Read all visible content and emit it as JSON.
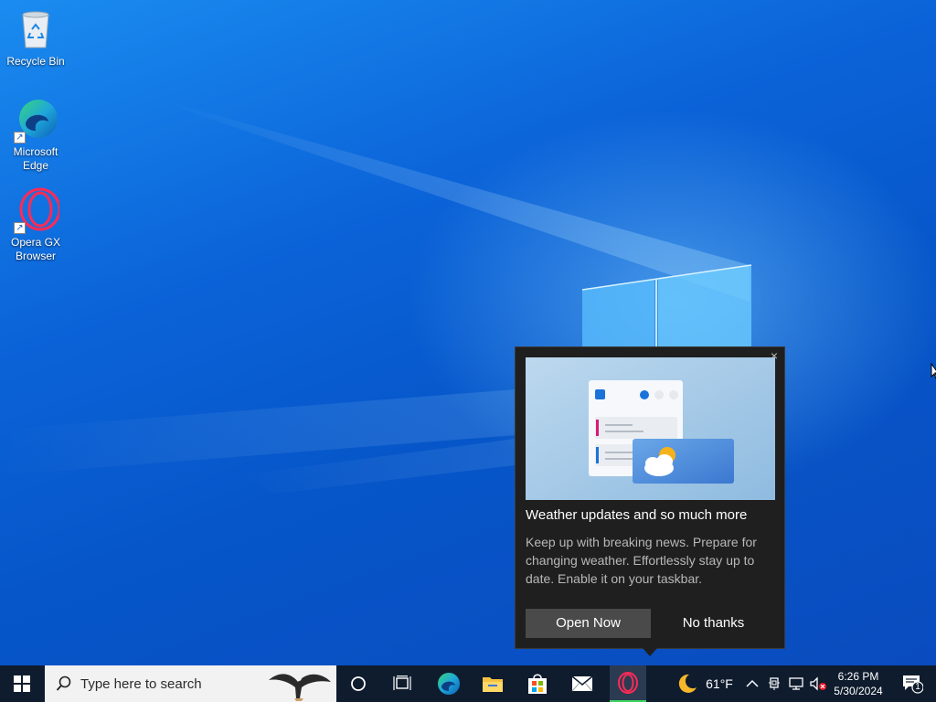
{
  "desktop": {
    "icons": [
      {
        "label": "Recycle Bin",
        "icon": "recycle-bin-icon"
      },
      {
        "label": "Microsoft Edge",
        "icon": "edge-icon"
      },
      {
        "label": "Opera GX Browser",
        "icon": "opera-gx-icon"
      }
    ]
  },
  "popup": {
    "title": "Weather updates and so much more",
    "description": "Keep up with breaking news. Prepare for changing weather. Effortlessly stay up to date. Enable it on your taskbar.",
    "open_label": "Open Now",
    "no_label": "No thanks",
    "close_glyph": "×"
  },
  "taskbar": {
    "search_placeholder": "Type here to search",
    "pinned": [
      "cortana-icon",
      "task-view-icon",
      "edge-icon",
      "file-explorer-icon",
      "microsoft-store-icon",
      "mail-icon",
      "opera-gx-icon"
    ],
    "weather": {
      "temp": "61°F",
      "icon": "moon-icon"
    },
    "time": "6:26 PM",
    "date": "5/30/2024",
    "notification_count": "1",
    "accent_color": "#3cd460"
  }
}
